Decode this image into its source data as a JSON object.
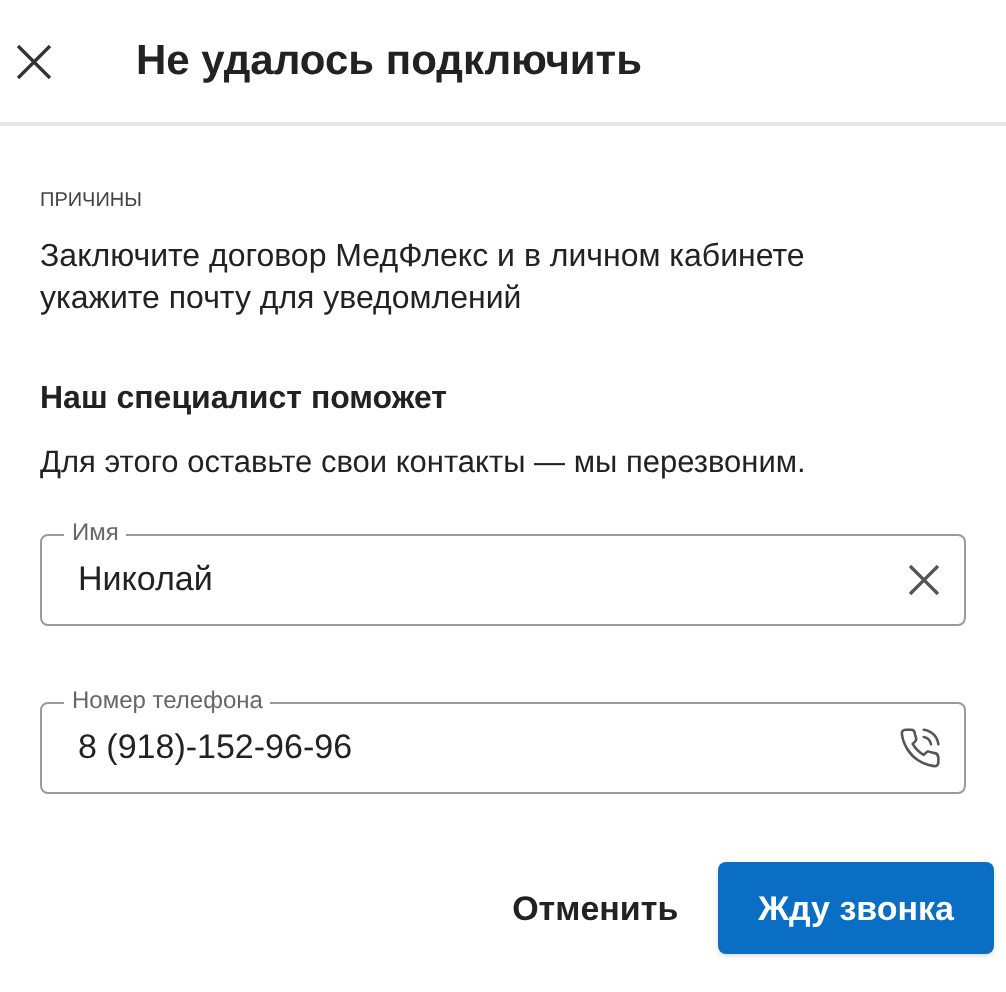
{
  "header": {
    "title": "Не удалось подключить"
  },
  "reasons": {
    "caption": "ПРИЧИНЫ",
    "text": "Заключите договор МедФлекс и в личном кабинете укажите почту для уведомлений"
  },
  "help": {
    "heading": "Наш специалист поможет",
    "text": "Для этого оставьте свои контакты — мы перезвоним."
  },
  "fields": [
    {
      "label": "Имя",
      "value": "Николай",
      "kind": "clear"
    },
    {
      "label": "Номер телефона",
      "value": "8 (918)-152-96-96",
      "kind": "phone"
    }
  ],
  "buttons": [
    {
      "label": "Отменить",
      "kind": "text"
    },
    {
      "label": "Жду звонка",
      "kind": "primary"
    }
  ]
}
